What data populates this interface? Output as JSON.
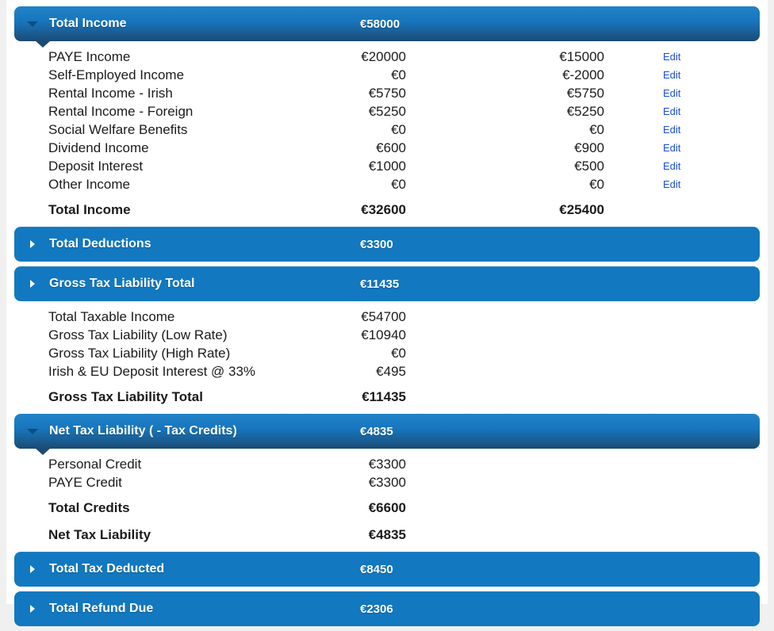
{
  "colors": {
    "header_blue": "#1278c0",
    "header_gradient_top": "#2183c9",
    "header_gradient_bottom": "#1b4a73",
    "link_blue": "#1a4fd8",
    "page_background": "#f0f0f0",
    "card_background": "#ffffff"
  },
  "sections": [
    {
      "id": "total-income",
      "title": "Total Income",
      "value": "€58000",
      "expanded": true,
      "caret": "caret-down-icon",
      "rows": [
        {
          "label": "PAYE Income",
          "v1": "€20000",
          "v2": "€15000",
          "edit": "Edit"
        },
        {
          "label": "Self-Employed Income",
          "v1": "€0",
          "v2": "€-2000",
          "edit": "Edit"
        },
        {
          "label": "Rental Income - Irish",
          "v1": "€5750",
          "v2": "€5750",
          "edit": "Edit"
        },
        {
          "label": "Rental Income - Foreign",
          "v1": "€5250",
          "v2": "€5250",
          "edit": "Edit"
        },
        {
          "label": "Social Welfare Benefits",
          "v1": "€0",
          "v2": "€0",
          "edit": "Edit"
        },
        {
          "label": "Dividend Income",
          "v1": "€600",
          "v2": "€900",
          "edit": "Edit"
        },
        {
          "label": "Deposit Interest",
          "v1": "€1000",
          "v2": "€500",
          "edit": "Edit"
        },
        {
          "label": "Other Income",
          "v1": "€0",
          "v2": "€0",
          "edit": "Edit"
        }
      ],
      "totals": [
        {
          "label": "Total Income",
          "v1": "€32600",
          "v2": "€25400"
        }
      ]
    },
    {
      "id": "total-deductions",
      "title": "Total Deductions",
      "value": "€3300",
      "expanded": false,
      "caret": "caret-right-icon",
      "rows": [],
      "totals": []
    },
    {
      "id": "gross-tax-liability-total",
      "title": "Gross Tax Liability Total",
      "value": "€11435",
      "expanded": false,
      "caret": "caret-right-icon",
      "rows": [
        {
          "label": "Total Taxable Income",
          "v1": "€54700"
        },
        {
          "label": "Gross Tax Liability (Low Rate)",
          "v1": "€10940"
        },
        {
          "label": "Gross Tax Liability (High Rate)",
          "v1": "€0"
        },
        {
          "label": "Irish & EU Deposit Interest @ 33%",
          "v1": "€495"
        }
      ],
      "totals": [
        {
          "label": "Gross Tax Liability Total",
          "v1": "€11435"
        }
      ]
    },
    {
      "id": "net-tax-liability",
      "title": "Net Tax Liability ( - Tax Credits)",
      "value": "€4835",
      "expanded": true,
      "caret": "caret-down-icon",
      "rows": [
        {
          "label": "Personal Credit",
          "v1": "€3300"
        },
        {
          "label": "PAYE Credit",
          "v1": "€3300"
        }
      ],
      "totals": [
        {
          "label": "Total Credits",
          "v1": "€6600"
        },
        {
          "label": "Net Tax Liability",
          "v1": "€4835"
        }
      ]
    },
    {
      "id": "total-tax-deducted",
      "title": "Total Tax Deducted",
      "value": "€8450",
      "expanded": false,
      "caret": "caret-right-icon",
      "rows": [],
      "totals": []
    },
    {
      "id": "total-refund-due",
      "title": "Total Refund Due",
      "value": "€2306",
      "expanded": false,
      "caret": "caret-right-icon",
      "rows": [],
      "totals": []
    }
  ]
}
